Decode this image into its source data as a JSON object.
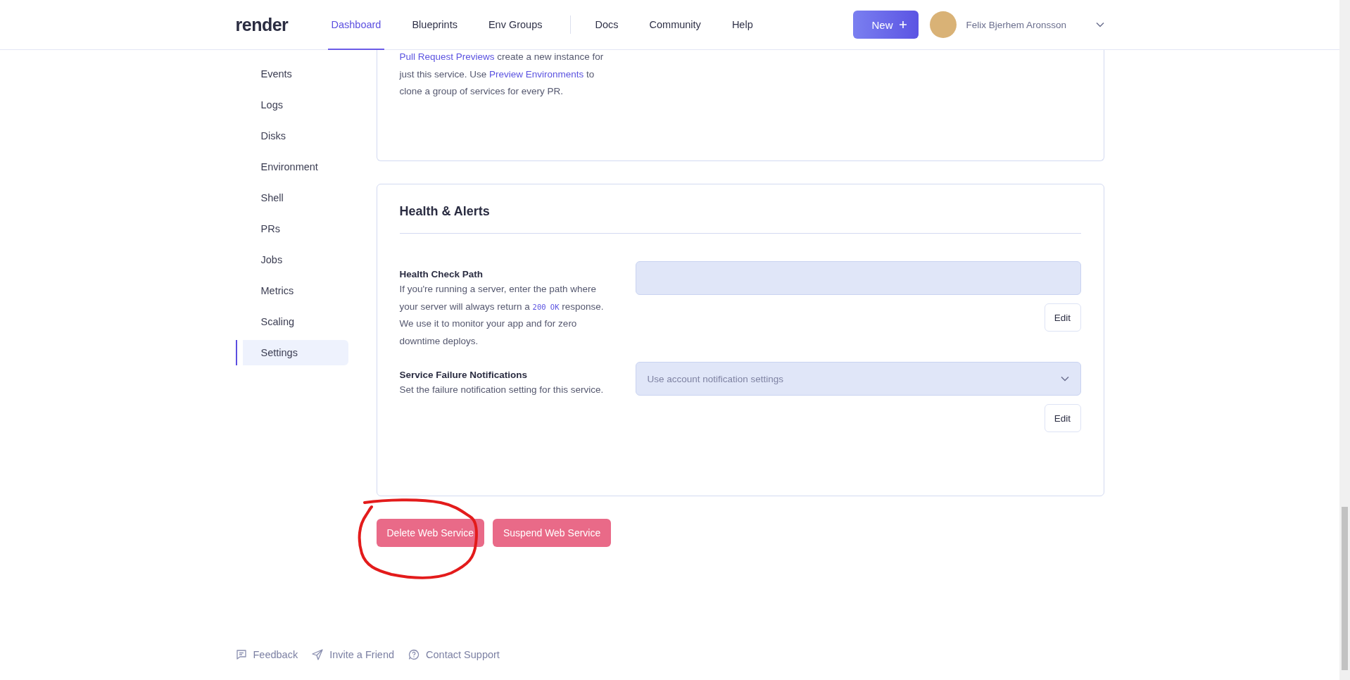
{
  "header": {
    "logo": "render",
    "primary_nav": [
      {
        "label": "Dashboard",
        "selected": true
      },
      {
        "label": "Blueprints",
        "selected": false
      },
      {
        "label": "Env Groups",
        "selected": false
      }
    ],
    "secondary_nav": [
      {
        "label": "Docs",
        "selected": false
      },
      {
        "label": "Community",
        "selected": false
      },
      {
        "label": "Help",
        "selected": false
      }
    ],
    "new_button": "New",
    "user_name": "Felix Bjerhem Aronsson"
  },
  "sidebar": {
    "items": [
      {
        "label": "Events",
        "selected": false
      },
      {
        "label": "Logs",
        "selected": false
      },
      {
        "label": "Disks",
        "selected": false
      },
      {
        "label": "Environment",
        "selected": false
      },
      {
        "label": "Shell",
        "selected": false
      },
      {
        "label": "PRs",
        "selected": false
      },
      {
        "label": "Jobs",
        "selected": false
      },
      {
        "label": "Metrics",
        "selected": false
      },
      {
        "label": "Scaling",
        "selected": false
      },
      {
        "label": "Settings",
        "selected": true
      }
    ]
  },
  "preview_card": {
    "description": [
      {
        "kind": "link",
        "text": "Pull Request Previews"
      },
      {
        "kind": "text",
        "text": " create a new instance for just this service. Use "
      },
      {
        "kind": "link",
        "text": "Preview Environments"
      },
      {
        "kind": "text",
        "text": " to clone a group of services for every PR."
      }
    ]
  },
  "health_card": {
    "title": "Health & Alerts",
    "settings": [
      {
        "kind": "input",
        "label": "Health Check Path",
        "description": [
          {
            "kind": "text",
            "text": "If you're running a server, enter the path where your server will always return a "
          },
          {
            "kind": "code",
            "text": "200 OK"
          },
          {
            "kind": "text",
            "text": " response. We use it to monitor your app and for zero downtime deploys."
          }
        ],
        "button": "Edit"
      },
      {
        "kind": "select",
        "label": "Service Failure Notifications",
        "description": [
          {
            "kind": "text",
            "text": "Set the failure notification setting for this service."
          }
        ],
        "value": "Use account notification settings",
        "button": "Edit"
      }
    ]
  },
  "danger_actions": [
    {
      "label": "Delete Web Service",
      "annotated": true
    },
    {
      "label": "Suspend Web Service",
      "annotated": false
    }
  ],
  "footer": {
    "links": [
      {
        "kind": "feedback",
        "label": "Feedback"
      },
      {
        "kind": "invite",
        "label": "Invite a Friend"
      },
      {
        "kind": "support",
        "label": "Contact Support"
      }
    ]
  }
}
